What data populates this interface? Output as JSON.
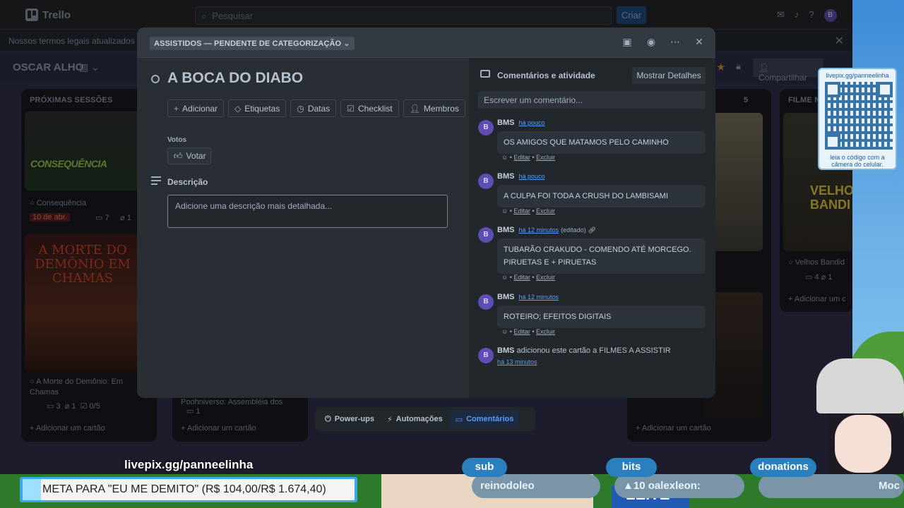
{
  "trello": {
    "app_name": "Trello",
    "search_placeholder": "Pesquisar",
    "create_label": "Criar",
    "notice": "Nossos termos legais atualizados en",
    "board_title": "OSCAR ALHO",
    "share_label": "Compartilhar",
    "columns": [
      {
        "title": "PRÓXIMAS SESSÕES",
        "cards": [
          {
            "poster_text": "CONSEQUÊNCIA",
            "title": "Consequência",
            "date": "10 de abr.",
            "comments": "7",
            "attachments": "1"
          },
          {
            "poster_text": "A MORTE DO DEMÔNIO EM CHAMAS",
            "title": "A Morte do Demônio: Em Chamas",
            "comments": "3",
            "attachments": "1",
            "checklist": "0/5"
          }
        ],
        "add_card": "Adicionar um cartão"
      },
      {
        "title": "",
        "cards": [
          {
            "title": "Poohniverso: Assembléia dos",
            "comments": "1"
          }
        ],
        "add_card": "Adicionar um cartão"
      },
      {
        "title": "",
        "count": "5",
        "add_card": "Adicionar um cartão"
      },
      {
        "title": "FILME N",
        "cards": [
          {
            "poster_text": "VELHOS BANDI",
            "title": "Velhos Bandid",
            "comments": "4",
            "attachments": "1"
          }
        ],
        "add_card": "Adicionar um c"
      }
    ]
  },
  "modal": {
    "list_name": "ASSISTIDOS — PENDENTE DE CATEGORIZAÇÃO",
    "card_title": "A BOCA DO DIABO",
    "actions": [
      {
        "icon": "plus-icon",
        "label": "Adicionar"
      },
      {
        "icon": "tag-icon",
        "label": "Etiquetas"
      },
      {
        "icon": "clock-icon",
        "label": "Datas"
      },
      {
        "icon": "checkbox-icon",
        "label": "Checklist"
      },
      {
        "icon": "user-icon",
        "label": "Membros"
      }
    ],
    "votes_label": "Votos",
    "vote_button": "Votar",
    "description_label": "Descrição",
    "description_placeholder": "Adicione uma descrição mais detalhada...",
    "comments_title": "Comentários e atividade",
    "show_details": "Mostrar Detalhes",
    "write_comment": "Escrever um comentário...",
    "comments": [
      {
        "author": "BMS",
        "initial": "B",
        "time": "há pouco",
        "edited": "",
        "text": "OS AMIGOS QUE MATAMOS PELO CAMINHO"
      },
      {
        "author": "BMS",
        "initial": "B",
        "time": "há pouco",
        "edited": "",
        "text": "A CULPA FOI TODA A CRUSH DO LAMBISAMI"
      },
      {
        "author": "BMS",
        "initial": "B",
        "time": "há 12 minutos",
        "edited": "(editado)",
        "text": "TUBARÃO CRAKUDO - COMENDO ATÉ MORCEGO. PIRUETAS E + PIRUETAS"
      },
      {
        "author": "BMS",
        "initial": "B",
        "time": "há 12 minutos",
        "edited": "",
        "text": "ROTEIRO; EFEITOS DIGITAIS"
      }
    ],
    "comment_edit": "Editar",
    "comment_delete": "Excluir",
    "activity": {
      "author": "BMS",
      "initial": "B",
      "text": "adicionou este cartão a FILMES A ASSISTIR",
      "time": "há 13 minutos"
    },
    "bottom_bar": [
      {
        "icon": "power-icon",
        "label": "Power-ups",
        "active": false
      },
      {
        "icon": "bolt-icon",
        "label": "Automações",
        "active": false
      },
      {
        "icon": "comment-icon",
        "label": "Comentários",
        "active": true
      }
    ]
  },
  "overlay": {
    "qr_url": "livepix.gg/panneelinha",
    "qr_caption": "leia o código com a câmera do celular.",
    "livepix_url": "livepix.gg/panneelinha",
    "goal_text": "META PARA \"EU ME DEMITO\" (R$ 104,00/R$ 1.674,40)",
    "goal_progress": 0.062,
    "tags": [
      {
        "label": "sub",
        "name": "reinodoleo"
      },
      {
        "label": "bits",
        "name": "10   oalexleon:"
      },
      {
        "label": "donations",
        "name": "Moc"
      }
    ],
    "cartoon_text": "LEITE"
  },
  "colors": {
    "accent": "#579dff",
    "avatar": "#5e4db2",
    "modal_bg": "#282e33",
    "panel_bg": "#22272b"
  }
}
